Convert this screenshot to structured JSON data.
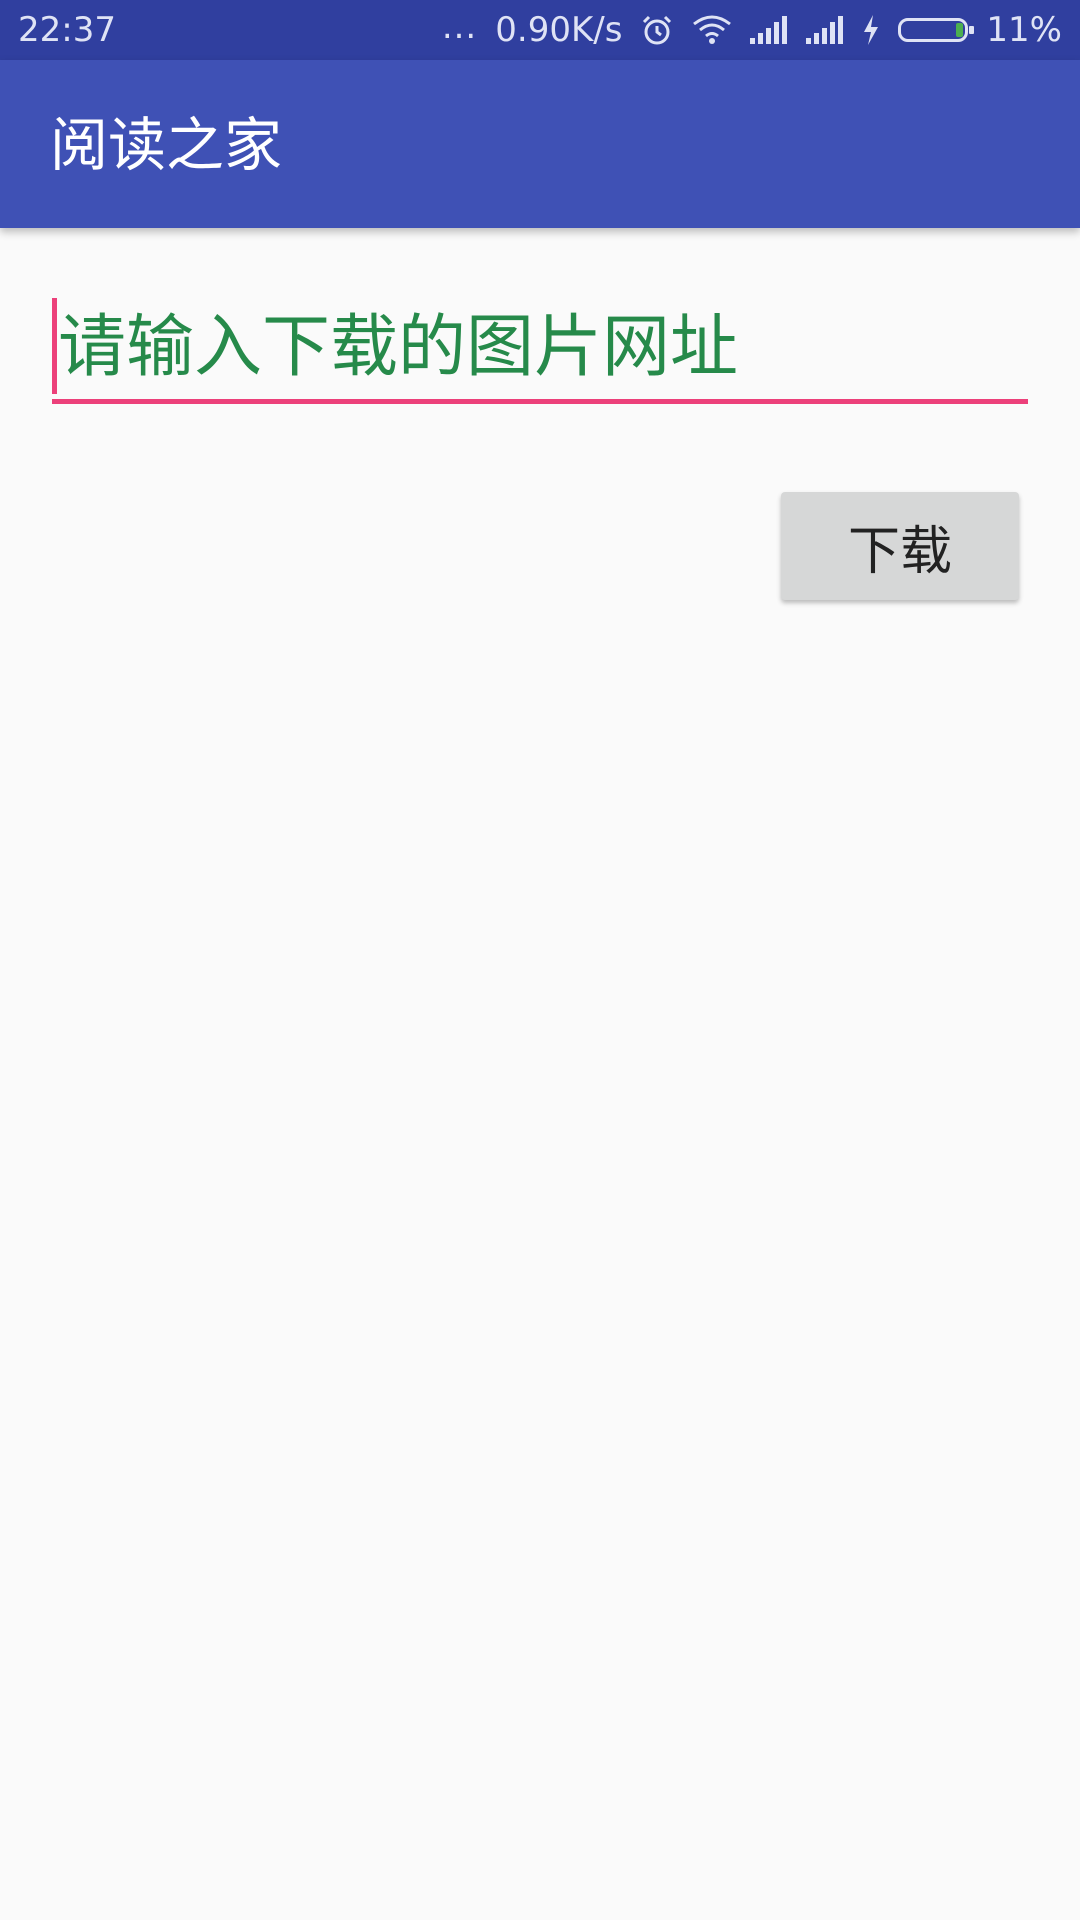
{
  "status_bar": {
    "time": "22:37",
    "more_indicator": "...",
    "network_speed": "0.90K/s",
    "icons": [
      "alarm-icon",
      "wifi-icon",
      "signal-icon",
      "signal-icon",
      "charging-icon",
      "battery-icon"
    ],
    "battery_percent": "11%",
    "battery_level": 0.11,
    "battery_color": "#4caf50"
  },
  "app_bar": {
    "title": "阅读之家",
    "color": "#3f51b5"
  },
  "main": {
    "url_input": {
      "placeholder": "请输入下载的图片网址",
      "text_color": "#268a4a",
      "accent_color": "#ec407a"
    },
    "download_button": {
      "label": "下载"
    }
  }
}
